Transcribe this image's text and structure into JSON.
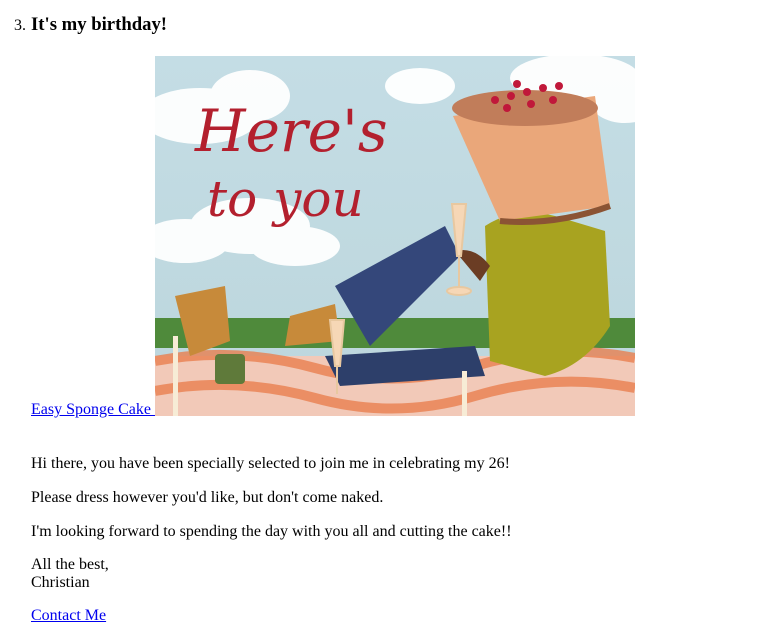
{
  "section": {
    "number": "3.",
    "title": "It's my birthday!"
  },
  "cake_link": "Easy Sponge Cake ",
  "hero_image": {
    "caption_line1": "Here's",
    "caption_line2": "to you"
  },
  "paragraphs": [
    "Hi there, you have been specially selected to join me in celebrating my 26!",
    "Please dress however you'd like, but don't come naked.",
    "I'm looking forward to spending the day with you all and cutting the cake!!"
  ],
  "signoff": {
    "line1": "All the best,",
    "line2": "Christian"
  },
  "contact_link": "Contact Me",
  "colors": {
    "link": "#0000ee",
    "script_red": "#b3202e",
    "sky": "#c9dfe6",
    "grass": "#4f8a3b"
  }
}
